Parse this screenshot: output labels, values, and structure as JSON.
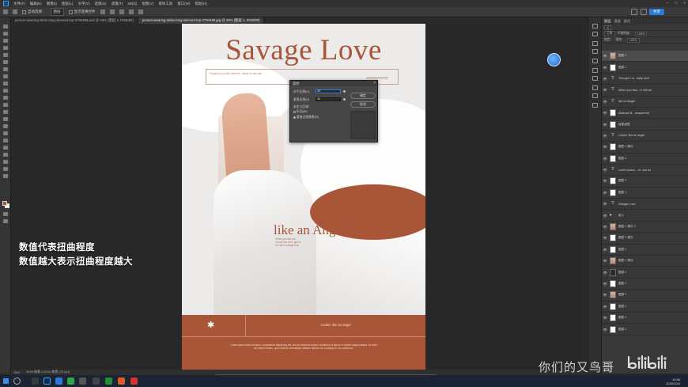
{
  "menubar": {
    "items": [
      "文件(F)",
      "编辑(E)",
      "图像(I)",
      "图层(L)",
      "文字(Y)",
      "选择(S)",
      "滤镜(T)",
      "3D(D)",
      "视图(V)",
      "增效工具",
      "窗口(W)",
      "帮助(H)"
    ],
    "window_controls": [
      "–",
      "□",
      "×"
    ]
  },
  "optionsbar": {
    "auto_select_label": "自动选择：",
    "auto_select_target": "图层",
    "transform_controls_label": "显示变换控件",
    "share_label": "共享"
  },
  "tabs": [
    {
      "label": "person-wearing-white-long-sleeved-top-2794488.psd @ 25% (图层 4, RGB/8#)"
    },
    {
      "label": "person-wearing-white-long-sleeved-top-2794488.jpg @ 25% (图层 1, RGB/8#)",
      "active": true
    }
  ],
  "poster": {
    "title": "Savage Love",
    "subtitle": "Thought you really loved me, bandy on the way",
    "angel_text": "like an Angel",
    "angel_sub": "When you kiss me\nI know you don't give a\nI'm still a savage love",
    "footer_tagline": "Lookin' like an angel",
    "footer_star": "✱",
    "footer_body": "Lorem ipsum dolor sit amet, consectetur adipiscing elit, sed do eiusmod tempor incididunt ut labore et dolore magna aliqua. Ut enim ad minim veniam, quis nostrud exercitation ullamco laboris nisi ut aliquip ex ea commodo."
  },
  "dialog": {
    "title": "波纹",
    "close": "×",
    "horizontal_label": "水平比例(H)",
    "horizontal_value": "40",
    "vertical_label": "垂直比例(V)",
    "vertical_value": "40",
    "undefined_area_label": "未定义区域：",
    "option_wrap": "折回(W)",
    "option_repeat": "重复边缘像素(R)",
    "ok_label": "确定",
    "cancel_label": "取消"
  },
  "overlay": {
    "line1": "数值代表扭曲程度",
    "line2": "数值越大表示扭曲程度越大"
  },
  "statusbar": {
    "zoom": "25%",
    "doc_info": "3496 像素 x 5244 像素 (72 ppi)"
  },
  "layers_panel": {
    "tabs": [
      "图层",
      "通道",
      "路径"
    ],
    "mode": "正常",
    "opacity_label": "不透明度：",
    "opacity_value": "100%",
    "lock_label": "锁定：",
    "fill_label": "填充：",
    "fill_value": "100%",
    "layers": [
      {
        "name": "图层 3",
        "kind": "photo",
        "selected": true
      },
      {
        "name": "图层 2",
        "kind": "white"
      },
      {
        "name": "Thought I ro...eally don't",
        "kind": "text"
      },
      {
        "name": "When you kiss...t I still ws",
        "kind": "text"
      },
      {
        "name": "like an Angel",
        "kind": "text"
      },
      {
        "name": "Abstract Ill....ansparent)",
        "kind": "white"
      },
      {
        "name": "智能滤镜",
        "kind": "white"
      },
      {
        "name": "Lookin' like an angel",
        "kind": "text"
      },
      {
        "name": "图层 4 拷贝",
        "kind": "white"
      },
      {
        "name": "图层 4",
        "kind": "white"
      },
      {
        "name": "Lorem ipsum ...iit, sed do",
        "kind": "text"
      },
      {
        "name": "图层 3",
        "kind": "white"
      },
      {
        "name": "图层 1",
        "kind": "white"
      },
      {
        "name": "Savage Love",
        "kind": "text"
      },
      {
        "name": "组 1",
        "kind": "folder"
      },
      {
        "name": "图层 2 拷贝 2",
        "kind": "photo"
      },
      {
        "name": "图层 2 拷贝",
        "kind": "white"
      },
      {
        "name": "图层 2",
        "kind": "white"
      },
      {
        "name": "图层 1 拷贝",
        "kind": "photo"
      },
      {
        "name": "图层 0",
        "kind": "dark"
      },
      {
        "name": "图层 1",
        "kind": "white"
      },
      {
        "name": "图层 0",
        "kind": "photo"
      },
      {
        "name": "图层 0",
        "kind": "white"
      },
      {
        "name": "图层 1",
        "kind": "white"
      },
      {
        "name": "图层 0",
        "kind": "white"
      }
    ]
  },
  "taskbar": {
    "time": "14:56",
    "date": "2020/10/4"
  },
  "watermark": {
    "text": "你们的又鸟哥",
    "logo": "bilibili"
  },
  "colors": {
    "accent": "#a85538",
    "panel": "#383838",
    "canvas_bg": "#282828"
  }
}
